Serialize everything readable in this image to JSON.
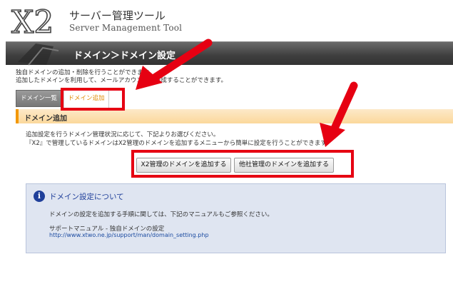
{
  "header": {
    "logo_text": "X2",
    "brand_jp": "サーバー管理ツール",
    "brand_en": "Server Management Tool"
  },
  "titlebar": {
    "title": "ドメイン＞ドメイン設定"
  },
  "description": [
    "独自ドメインの追加・削除を行うことができます。",
    "追加したドメインを利用して、メールアカウントを作成することができます。"
  ],
  "tabs": [
    {
      "label": "ドメイン一覧"
    },
    {
      "label": "ドメイン追加"
    }
  ],
  "section": {
    "title": "ドメイン追加",
    "text": [
      "追加設定を行うドメイン管理状況に応じて、下記よりお選びください。",
      "『X2』で管理しているドメインはX2管理のドメインを追加するメニューから簡単に設定を行うことができます。"
    ]
  },
  "buttons": {
    "x2_label": "X2管理のドメインを追加する",
    "other_label": "他社管理のドメインを追加する"
  },
  "notice": {
    "icon_glyph": "i",
    "title": "ドメイン設定について",
    "body": "ドメインの設定を追加する手順に関しては、下記のマニュアルもご参照ください。",
    "manual_name": "サポートマニュアル - 独自ドメインの設定",
    "manual_url": "http://www.xtwo.ne.jp/support/man/domain_setting.php"
  },
  "colors": {
    "accent_orange": "#f39800",
    "highlight_red": "#e60012",
    "notice_bg": "#dfe5f1"
  }
}
